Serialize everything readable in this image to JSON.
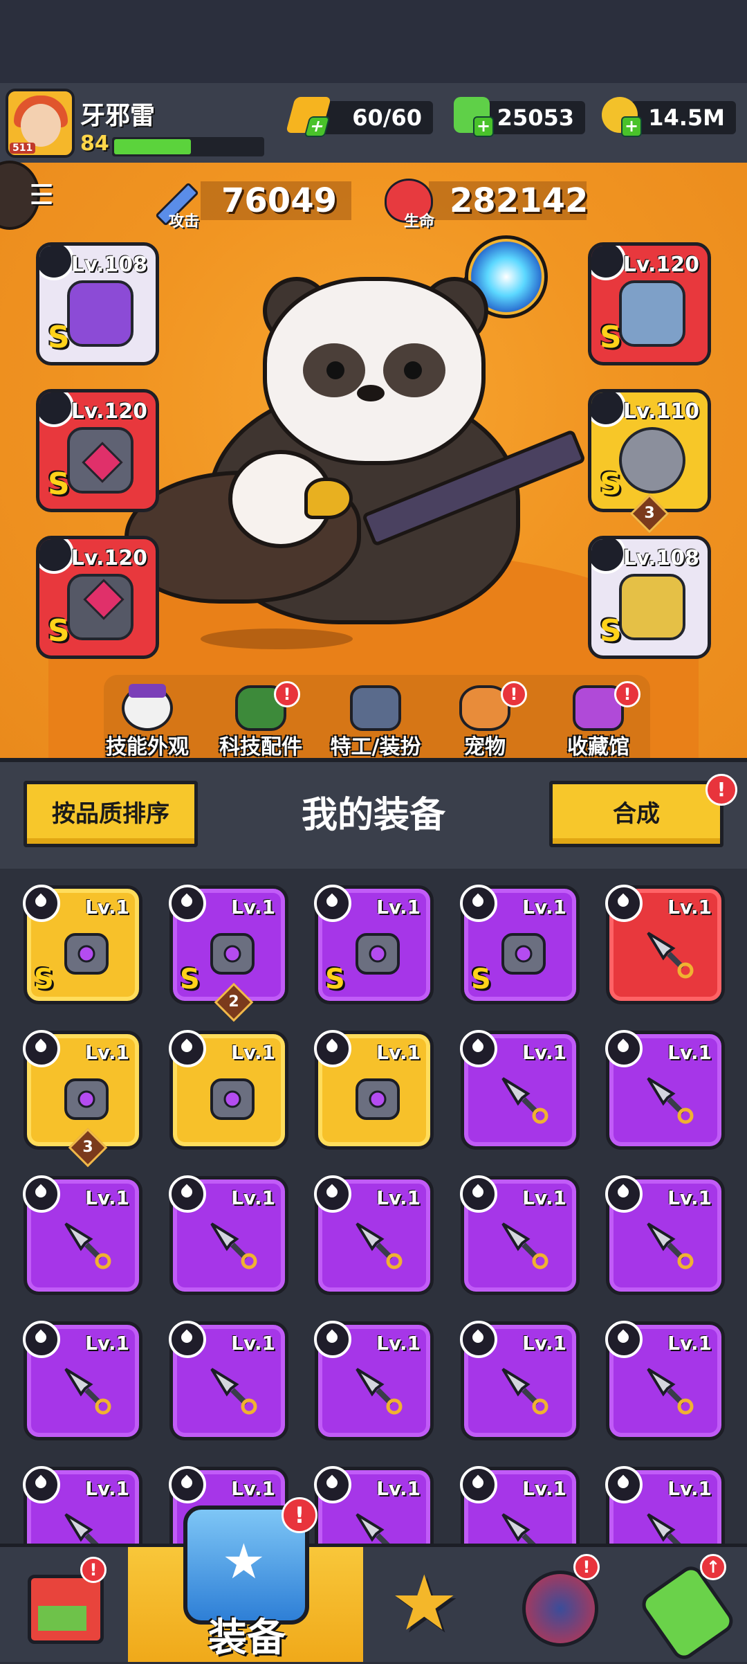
{
  "player": {
    "name": "牙邪雷",
    "level": "84",
    "xp_fraction": 0.52,
    "avatar_badge": "511"
  },
  "resources": {
    "energy": "60/60",
    "gems": "25053",
    "gold": "14.5M"
  },
  "stats": {
    "attack_value": "76049",
    "attack_label": "攻击",
    "hp_value": "282142",
    "hp_label": "生命"
  },
  "equipped": {
    "weapon": {
      "level": "Lv.108",
      "grade": "S",
      "icon": "staff-icon"
    },
    "necklace": {
      "level": "Lv.120",
      "grade": "S",
      "icon": "chain-necklace-icon"
    },
    "gloves": {
      "level": "Lv.120",
      "grade": "S",
      "icon": "gauntlet-icon"
    },
    "armor": {
      "level": "Lv.120",
      "grade": "S",
      "icon": "armor-icon"
    },
    "belt": {
      "level": "Lv.110",
      "grade": "S",
      "stack": "3",
      "icon": "belt-icon"
    },
    "boots": {
      "level": "Lv.108",
      "grade": "S",
      "icon": "boots-icon"
    }
  },
  "features": [
    {
      "label": "技能外观",
      "icon": "soccer-hat-icon",
      "alert": false
    },
    {
      "label": "科技配件",
      "icon": "tech-part-icon",
      "alert": true
    },
    {
      "label": "特工/装扮",
      "icon": "agent-icon",
      "alert": false
    },
    {
      "label": "宠物",
      "icon": "shiba-icon",
      "alert": true
    },
    {
      "label": "收藏馆",
      "icon": "collection-chest-icon",
      "alert": true
    }
  ],
  "panel": {
    "sort_label": "按品质排序",
    "title": "我的装备",
    "merge_label": "合成"
  },
  "inventory": [
    {
      "level": "Lv.1",
      "color": "gold",
      "grade": "S",
      "item": "belt-icon"
    },
    {
      "level": "Lv.1",
      "color": "purple",
      "grade": "S",
      "item": "armor-icon",
      "stack": "2"
    },
    {
      "level": "Lv.1",
      "color": "purple",
      "grade": "S",
      "item": "staff-icon"
    },
    {
      "level": "Lv.1",
      "color": "purple",
      "grade": "S",
      "item": "chain-necklace-icon"
    },
    {
      "level": "Lv.1",
      "color": "red",
      "grade": "",
      "item": "kunai-icon"
    },
    {
      "level": "Lv.1",
      "color": "gold",
      "grade": "",
      "item": "boots-icon",
      "stack": "3"
    },
    {
      "level": "Lv.1",
      "color": "gold",
      "grade": "",
      "item": "fang-necklace-icon"
    },
    {
      "level": "Lv.1",
      "color": "gold",
      "grade": "",
      "item": "gauntlet-icon"
    },
    {
      "level": "Lv.1",
      "color": "purple",
      "grade": "",
      "item": "kunai-icon"
    },
    {
      "level": "Lv.1",
      "color": "purple",
      "grade": "",
      "item": "kunai-icon"
    },
    {
      "level": "Lv.1",
      "color": "purple",
      "grade": "",
      "item": "kunai-icon"
    },
    {
      "level": "Lv.1",
      "color": "purple",
      "grade": "",
      "item": "kunai-icon"
    },
    {
      "level": "Lv.1",
      "color": "purple",
      "grade": "",
      "item": "kunai-icon"
    },
    {
      "level": "Lv.1",
      "color": "purple",
      "grade": "",
      "item": "kunai-icon"
    },
    {
      "level": "Lv.1",
      "color": "purple",
      "grade": "",
      "item": "kunai-icon"
    },
    {
      "level": "Lv.1",
      "color": "purple",
      "grade": "",
      "item": "kunai-icon"
    },
    {
      "level": "Lv.1",
      "color": "purple",
      "grade": "",
      "item": "kunai-icon"
    },
    {
      "level": "Lv.1",
      "color": "purple",
      "grade": "",
      "item": "kunai-icon"
    },
    {
      "level": "Lv.1",
      "color": "purple",
      "grade": "",
      "item": "kunai-icon"
    },
    {
      "level": "Lv.1",
      "color": "purple",
      "grade": "",
      "item": "kunai-icon"
    },
    {
      "level": "Lv.1",
      "color": "purple",
      "grade": "",
      "item": "kunai-icon"
    },
    {
      "level": "Lv.1",
      "color": "purple",
      "grade": "",
      "item": "kunai-icon"
    },
    {
      "level": "Lv.1",
      "color": "purple",
      "grade": "",
      "item": "kunai-icon"
    },
    {
      "level": "Lv.1",
      "color": "purple",
      "grade": "",
      "item": "kunai-icon"
    },
    {
      "level": "Lv.1",
      "color": "purple",
      "grade": "",
      "item": "kunai-icon"
    }
  ],
  "nav": {
    "shop_icon": "shop-icon",
    "equip_label": "装备",
    "battle_icon": "crossed-swords-star-icon",
    "talent_icon": "star-orb-icon",
    "evolve_icon": "dna-capsule-icon"
  },
  "colors": {
    "accent": "#f7c72b",
    "hero_bg": "#f19522",
    "purple": "#a636e8",
    "red": "#e8383d",
    "alert": "#e8343c"
  }
}
